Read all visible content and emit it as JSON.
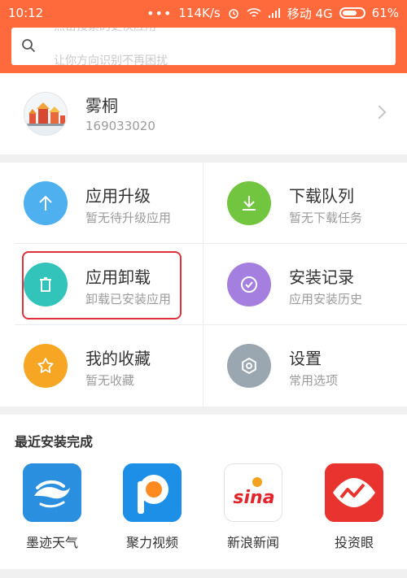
{
  "colors": {
    "accent": "#ff6a3d",
    "highlight_border": "#e0303c"
  },
  "status_bar": {
    "time": "10:12",
    "dots": "•••",
    "speed": "114K/s",
    "carrier": "移动 4G",
    "battery": "61%"
  },
  "search": {
    "hint_top": "点击搜索的更快应用",
    "hint_bottom": "让你方向识别不再困扰",
    "icon": "search-icon"
  },
  "profile": {
    "name": "雾桐",
    "id": "169033020",
    "icon": "chevron-right-icon"
  },
  "menu": [
    {
      "title": "应用升级",
      "subtitle": "暂无待升级应用",
      "icon": "arrow-up-icon",
      "color": "#4fb0f0"
    },
    {
      "title": "下载队列",
      "subtitle": "暂无下载任务",
      "icon": "download-icon",
      "color": "#72c53f"
    },
    {
      "title": "应用卸载",
      "subtitle": "卸载已安装应用",
      "icon": "trash-icon",
      "color": "#32c4bb"
    },
    {
      "title": "安装记录",
      "subtitle": "应用安装历史",
      "icon": "check-circle-icon",
      "color": "#a47fdf"
    },
    {
      "title": "我的收藏",
      "subtitle": "暂无收藏",
      "icon": "star-icon",
      "color": "#f6a623"
    },
    {
      "title": "设置",
      "subtitle": "常用选项",
      "icon": "gear-icon",
      "color": "#9aa6b0"
    }
  ],
  "recent": {
    "title": "最近安装完成",
    "apps": [
      {
        "name": "墨迹天气",
        "icon": "moji-weather-icon",
        "is_new": true
      },
      {
        "name": "聚力视频",
        "icon": "pptv-icon",
        "is_new": false
      },
      {
        "name": "新浪新闻",
        "icon": "sina-news-icon",
        "is_new": false
      },
      {
        "name": "投资眼",
        "icon": "touziyan-icon",
        "is_new": false
      }
    ],
    "sina_logo_text": "sina"
  }
}
